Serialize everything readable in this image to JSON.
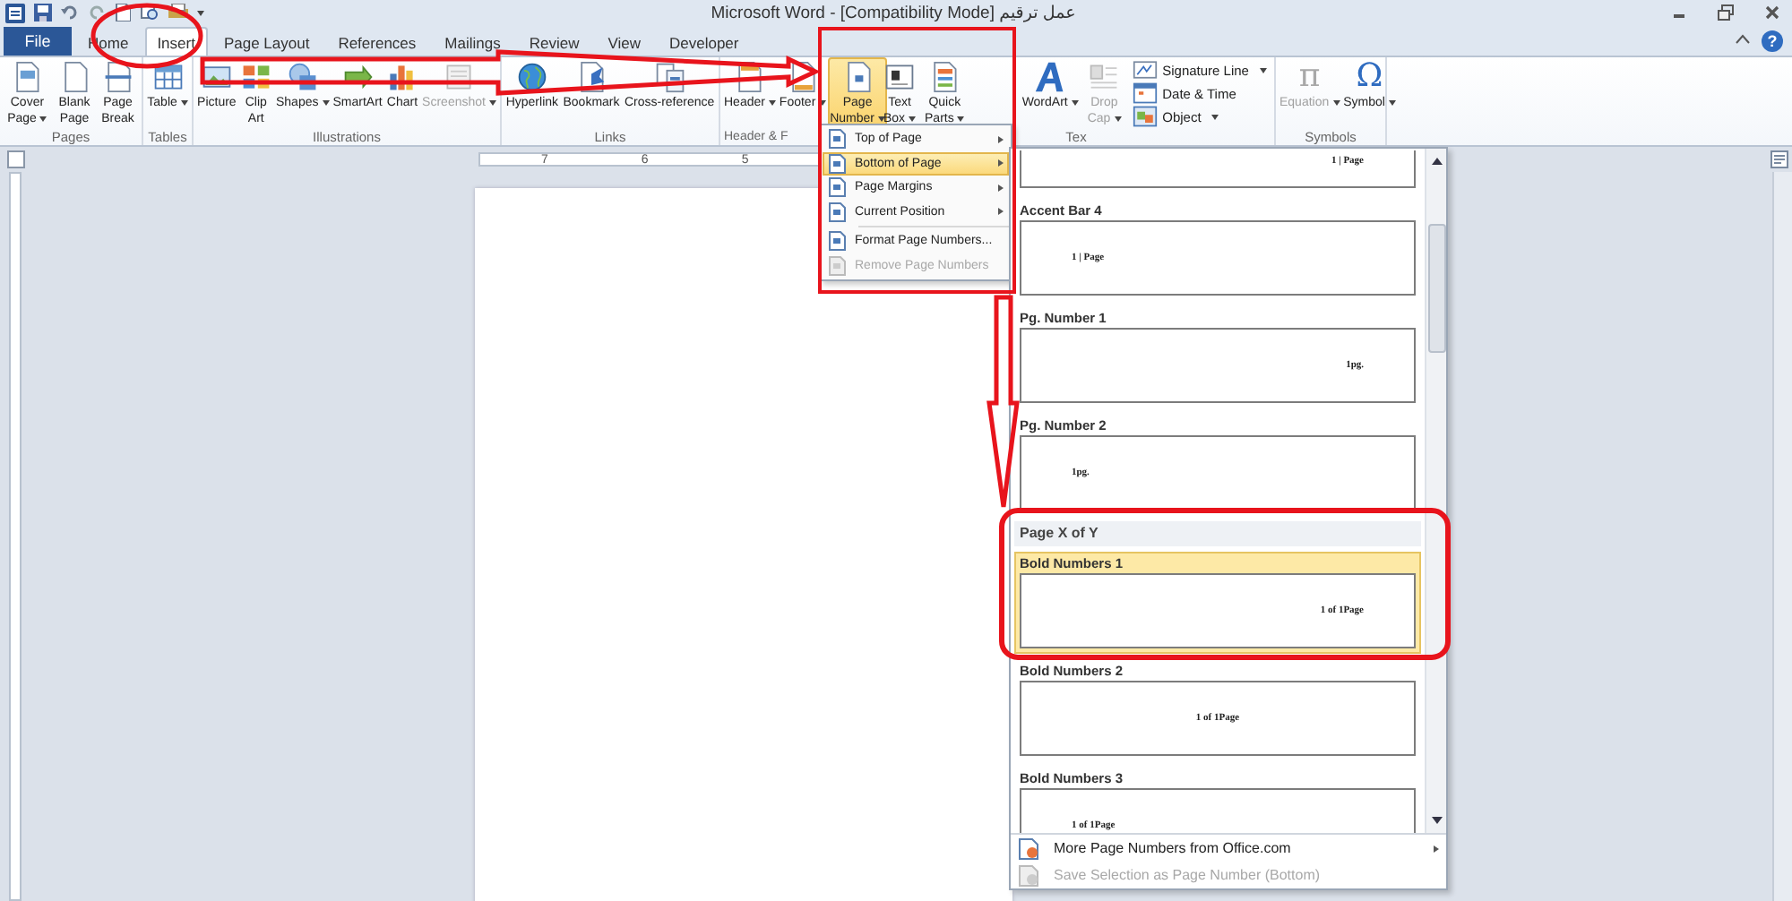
{
  "window": {
    "title": "عمل ترقيم [Compatibility Mode] - Microsoft Word"
  },
  "tabs": [
    {
      "label": "File",
      "kind": "file",
      "selected": false
    },
    {
      "label": "Home",
      "kind": "tab",
      "selected": false
    },
    {
      "label": "Insert",
      "kind": "tab",
      "selected": true
    },
    {
      "label": "Page Layout",
      "kind": "tab",
      "selected": false
    },
    {
      "label": "References",
      "kind": "tab",
      "selected": false
    },
    {
      "label": "Mailings",
      "kind": "tab",
      "selected": false
    },
    {
      "label": "Review",
      "kind": "tab",
      "selected": false
    },
    {
      "label": "View",
      "kind": "tab",
      "selected": false
    },
    {
      "label": "Developer",
      "kind": "tab",
      "selected": false
    }
  ],
  "help": "?",
  "ribbon_groups": [
    {
      "label": "Pages",
      "buttons": [
        {
          "label": "Cover Page",
          "dropdown": true,
          "disabled": false,
          "selected": false
        },
        {
          "label": "Blank Page",
          "dropdown": false,
          "disabled": false,
          "selected": false
        },
        {
          "label": "Page Break",
          "dropdown": false,
          "disabled": false,
          "selected": false
        }
      ]
    },
    {
      "label": "Tables",
      "buttons": [
        {
          "label": "Table",
          "dropdown": true,
          "disabled": false,
          "selected": false
        }
      ]
    },
    {
      "label": "Illustrations",
      "buttons": [
        {
          "label": "Picture",
          "dropdown": false,
          "disabled": false,
          "selected": false
        },
        {
          "label": "Clip Art",
          "dropdown": false,
          "disabled": false,
          "selected": false
        },
        {
          "label": "Shapes",
          "dropdown": true,
          "disabled": false,
          "selected": false
        },
        {
          "label": "SmartArt",
          "dropdown": false,
          "disabled": false,
          "selected": false
        },
        {
          "label": "Chart",
          "dropdown": false,
          "disabled": false,
          "selected": false
        },
        {
          "label": "Screenshot",
          "dropdown": true,
          "disabled": true,
          "selected": false
        }
      ]
    },
    {
      "label": "Links",
      "buttons": [
        {
          "label": "Hyperlink",
          "dropdown": false,
          "disabled": false,
          "selected": false
        },
        {
          "label": "Bookmark",
          "dropdown": false,
          "disabled": false,
          "selected": false
        },
        {
          "label": "Cross-reference",
          "dropdown": false,
          "disabled": false,
          "selected": false
        }
      ]
    },
    {
      "label": "Header & F",
      "buttons": [
        {
          "label": "Header",
          "dropdown": true,
          "disabled": false,
          "selected": false
        },
        {
          "label": "Footer",
          "dropdown": true,
          "disabled": false,
          "selected": false
        },
        {
          "label": "Page Number",
          "dropdown": true,
          "disabled": false,
          "selected": true
        }
      ]
    },
    {
      "label": "Tex",
      "buttons": [
        {
          "label": "Text Box",
          "dropdown": true,
          "disabled": false,
          "selected": false
        },
        {
          "label": "Quick Parts",
          "dropdown": true,
          "disabled": false,
          "selected": false
        },
        {
          "label": "WordArt",
          "dropdown": true,
          "disabled": false,
          "selected": false
        },
        {
          "label": "Drop Cap",
          "dropdown": true,
          "disabled": true,
          "selected": false
        }
      ],
      "small_buttons": [
        {
          "label": "Signature Line",
          "dropdown": true,
          "disabled": false
        },
        {
          "label": "Date & Time",
          "dropdown": false,
          "disabled": false
        },
        {
          "label": "Object",
          "dropdown": true,
          "disabled": false
        }
      ]
    },
    {
      "label": "Symbols",
      "buttons": [
        {
          "label": "Equation",
          "glyph": "π",
          "dropdown": true,
          "disabled": true,
          "selected": false
        },
        {
          "label": "Symbol",
          "glyph": "Ω",
          "dropdown": true,
          "disabled": false,
          "selected": false
        }
      ]
    }
  ],
  "ruler": {
    "labels": [
      "7",
      "6",
      "5"
    ]
  },
  "page_number_menu": [
    {
      "label": "Top of Page",
      "submenu": true,
      "selected": false,
      "disabled": false
    },
    {
      "label": "Bottom of Page",
      "submenu": true,
      "selected": true,
      "disabled": false
    },
    {
      "label": "Page Margins",
      "submenu": true,
      "selected": false,
      "disabled": false
    },
    {
      "label": "Current Position",
      "submenu": true,
      "selected": false,
      "disabled": false
    },
    {
      "label": "Format Page Numbers...",
      "submenu": false,
      "selected": false,
      "disabled": false
    },
    {
      "label": "Remove Page Numbers",
      "submenu": false,
      "selected": false,
      "disabled": true
    }
  ],
  "gallery": {
    "entries": [
      {
        "kind": "partial",
        "preview": "1 | Page",
        "selected": false
      },
      {
        "kind": "item",
        "label": "Accent Bar 4",
        "preview": "1 | Page",
        "selected": false
      },
      {
        "kind": "item",
        "label": "Pg. Number 1",
        "preview": "1pg.",
        "selected": false
      },
      {
        "kind": "item",
        "label": "Pg. Number 2",
        "preview": "1pg.",
        "selected": false
      },
      {
        "kind": "category",
        "label": "Page X of Y"
      },
      {
        "kind": "item",
        "label": "Bold Numbers 1",
        "preview": "1 of 1Page",
        "selected": true
      },
      {
        "kind": "item",
        "label": "Bold Numbers 2",
        "preview": "1 of 1Page",
        "selected": false
      },
      {
        "kind": "item",
        "label": "Bold Numbers 3",
        "preview": "1 of 1Page",
        "selected": false
      }
    ],
    "footer": [
      {
        "label": "More Page Numbers from Office.com",
        "submenu": true,
        "disabled": false
      },
      {
        "label": "Save Selection as Page Number (Bottom)",
        "submenu": false,
        "disabled": true
      }
    ]
  }
}
